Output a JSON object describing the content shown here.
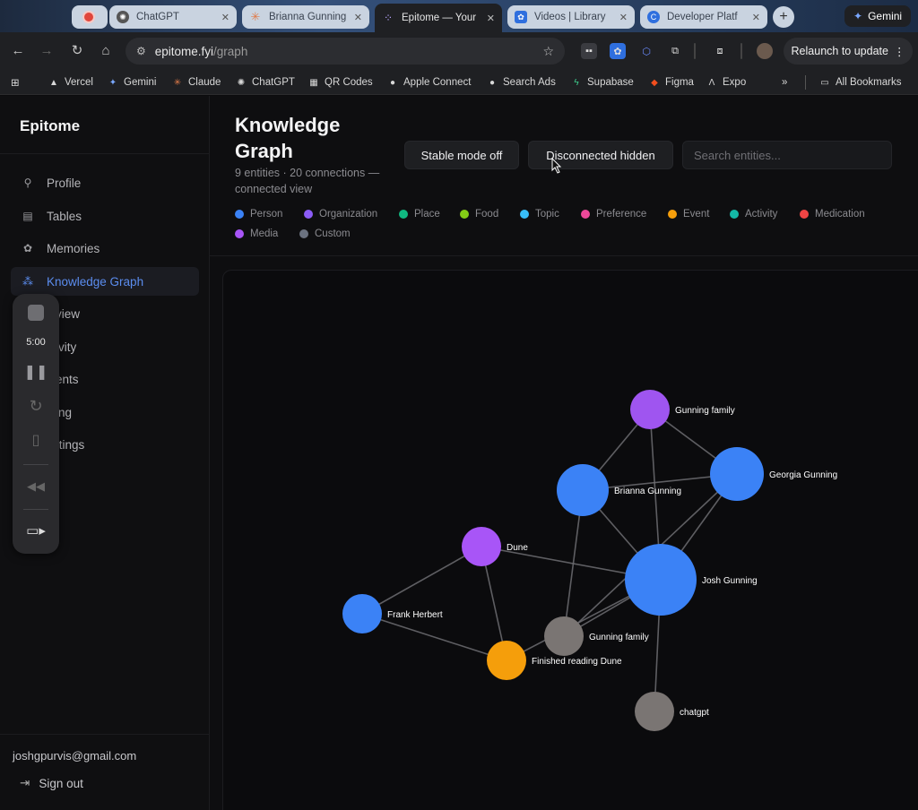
{
  "browser": {
    "tabs": [
      {
        "label": "",
        "color": "#e0463c",
        "icon": "record-icon"
      },
      {
        "label": "ChatGPT",
        "color": "#555555",
        "icon": "chatgpt-icon"
      },
      {
        "label": "Brianna Gunning",
        "color": "#e07b4a",
        "icon": "claude-icon"
      },
      {
        "label": "Epitome — Your",
        "color": "#222222",
        "icon": "epitome-icon"
      },
      {
        "label": "Videos | Library",
        "color": "#2f6fde",
        "icon": "videos-icon"
      },
      {
        "label": "Developer Platf",
        "color": "#2f6fde",
        "icon": "developer-icon"
      }
    ],
    "gemini_label": "Gemini",
    "url_host": "epitome.fyi",
    "url_path": "/graph",
    "relaunch_label": "Relaunch to update",
    "bookmarks": [
      "Vercel",
      "Gemini",
      "Claude",
      "ChatGPT",
      "QR Codes",
      "Apple Connect",
      "Search Ads",
      "Supabase",
      "Figma",
      "Expo"
    ],
    "all_bookmarks_label": "All Bookmarks"
  },
  "sidebar": {
    "brand": "Epitome",
    "items": [
      {
        "label": "Profile",
        "icon": "user-icon"
      },
      {
        "label": "Tables",
        "icon": "table-icon"
      },
      {
        "label": "Memories",
        "icon": "brain-icon"
      },
      {
        "label": "Knowledge Graph",
        "icon": "graph-icon"
      },
      {
        "label": "view",
        "icon": ""
      },
      {
        "label": "ivity",
        "icon": ""
      },
      {
        "label": "ents",
        "icon": ""
      },
      {
        "label": "ing",
        "icon": ""
      },
      {
        "label": "ttings",
        "icon": ""
      }
    ],
    "active_index": 3,
    "email": "joshgpurvis@gmail.com",
    "signout_label": "Sign out"
  },
  "recorder": {
    "time": "5:00"
  },
  "header": {
    "title": "Knowledge Graph",
    "subtitle": "9 entities · 20 connections — connected view",
    "stable_mode_label": "Stable mode off",
    "disconnected_label": "Disconnected hidden",
    "search_placeholder": "Search entities..."
  },
  "legend": [
    {
      "label": "Person",
      "color": "#3b82f6"
    },
    {
      "label": "Organization",
      "color": "#8b5cf6"
    },
    {
      "label": "Place",
      "color": "#10b981"
    },
    {
      "label": "Food",
      "color": "#84cc16"
    },
    {
      "label": "Topic",
      "color": "#38bdf8"
    },
    {
      "label": "Preference",
      "color": "#ec4899"
    },
    {
      "label": "Event",
      "color": "#f59e0b"
    },
    {
      "label": "Activity",
      "color": "#14b8a6"
    },
    {
      "label": "Medication",
      "color": "#ef4444"
    },
    {
      "label": "Media",
      "color": "#a855f7"
    },
    {
      "label": "Custom",
      "color": "#6b7280"
    }
  ],
  "graph": {
    "nodes": [
      {
        "id": "gunning_family_org",
        "label": "Gunning family",
        "type": "Organization",
        "color": "#9f55f0"
      },
      {
        "id": "georgia",
        "label": "Georgia Gunning",
        "type": "Person",
        "color": "#3b82f6"
      },
      {
        "id": "brianna",
        "label": "Brianna Gunning",
        "type": "Person",
        "color": "#3b82f6"
      },
      {
        "id": "dune",
        "label": "Dune",
        "type": "Media",
        "color": "#a855f7"
      },
      {
        "id": "josh",
        "label": "Josh Gunning",
        "type": "Person",
        "color": "#3b82f6"
      },
      {
        "id": "frank",
        "label": "Frank Herbert",
        "type": "Person",
        "color": "#3b82f6"
      },
      {
        "id": "gunning_family_custom",
        "label": "Gunning family",
        "type": "Custom",
        "color": "#7a7573"
      },
      {
        "id": "finished_dune",
        "label": "Finished reading Dune",
        "type": "Event",
        "color": "#f59e0b"
      },
      {
        "id": "chatgpt",
        "label": "chatgpt",
        "type": "Custom",
        "color": "#7a7573"
      }
    ],
    "edges": [
      [
        "gunning_family_org",
        "brianna"
      ],
      [
        "gunning_family_org",
        "georgia"
      ],
      [
        "gunning_family_org",
        "josh"
      ],
      [
        "brianna",
        "georgia"
      ],
      [
        "brianna",
        "josh"
      ],
      [
        "georgia",
        "josh"
      ],
      [
        "georgia",
        "gunning_family_custom"
      ],
      [
        "brianna",
        "gunning_family_custom"
      ],
      [
        "dune",
        "josh"
      ],
      [
        "dune",
        "frank"
      ],
      [
        "dune",
        "finished_dune"
      ],
      [
        "frank",
        "finished_dune"
      ],
      [
        "josh",
        "gunning_family_custom"
      ],
      [
        "josh",
        "finished_dune"
      ],
      [
        "josh",
        "chatgpt"
      ]
    ]
  }
}
